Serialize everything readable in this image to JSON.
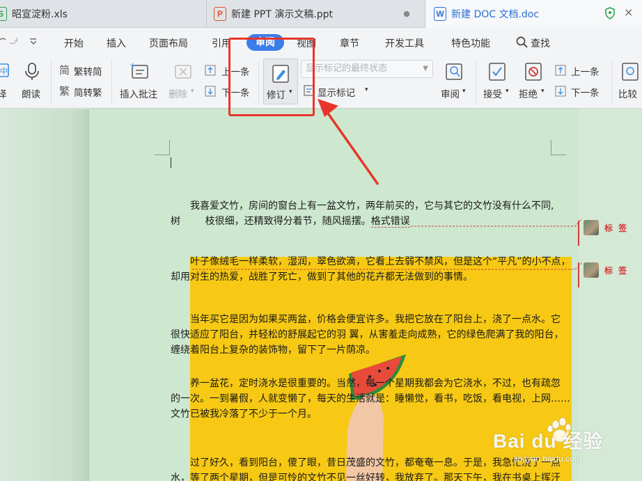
{
  "tabs": [
    {
      "icon": "S",
      "title": "昭宣淀粉.xls"
    },
    {
      "icon": "P",
      "title": "新建 PPT 演示文稿.ppt",
      "close": "●"
    },
    {
      "icon": "W",
      "title": "新建 DOC 文档.doc",
      "close": "×"
    }
  ],
  "menu": {
    "items": [
      "开始",
      "插入",
      "页面布局",
      "引用",
      "审阅",
      "视图",
      "章节",
      "开发工具",
      "特色功能"
    ],
    "active": "审阅",
    "search": "查找"
  },
  "ribbon": {
    "translate": "译",
    "read_aloud": "朗读",
    "trad": "繁转简",
    "simp": "简转繁",
    "insert_comment": "插入批注",
    "delete": "删除",
    "prev": "上一条",
    "next": "下一条",
    "track": "修订",
    "markup_view": "显示标记的最终状态",
    "show_markup": "显示标记",
    "review": "审阅",
    "accept": "接受",
    "reject": "拒绝",
    "prev2": "上一条",
    "next2": "下一条",
    "compare": "比较"
  },
  "document": {
    "p1": [
      "我喜爱文竹，房间的窗台上有一盆文竹，两年前买的，它与其它的文竹没有什么不同,",
      "树        枝很细，还精致得分着节，随风摇摆。",
      "格式错误"
    ],
    "p2": [
      "叶子像绒毛一样柔软，湿润，翠色欲滴，它看上去弱不禁风，但是这个“平凡”的小不点，",
      "却用对生的热爱，战胜了死亡，做到了其他的花卉都无法做到的事情。"
    ],
    "p3": [
      "当年买它是因为如果买两盆，价格会便宜许多。我把它放在了阳台上，浇了一点水。它",
      "很快适应了阳台，并轻松的舒展起它的羽  翼，从害羞走向成熟，它的绿色爬满了我的阳台，",
      "缠绕着阳台上复杂的装饰物，留下了一片荫凉。"
    ],
    "p4": [
      "养一盆花，定时浇水是很重要的。当然，每一个星期我都会为它浇水，不过，也有疏忽",
      "的一次。一到暑假，人就变懒了，每天的生活就是：睡懒觉，看书，吃饭，看电视，上网……",
      "文竹已被我冷落了不少于一个月。"
    ],
    "p5": [
      "过了好久，看到阳台，傻了眼，昔日茂盛的文竹，都奄奄一息。于是，我急忙浇了一点",
      "水，等了两个星期，但是可怜的文竹不见一丝好转，我放弃了。那天下午，我在书桌上挥汗"
    ]
  },
  "comments": [
    "标 签",
    "标 签"
  ],
  "watermark": {
    "brand": "Bai du 经验",
    "url": "jingyan.baidu.com"
  },
  "colors": {
    "accent": "#3b7de9",
    "annotation": "#e8352b",
    "page_bg": "#cde8cf",
    "image_bg": "#f7c914"
  }
}
